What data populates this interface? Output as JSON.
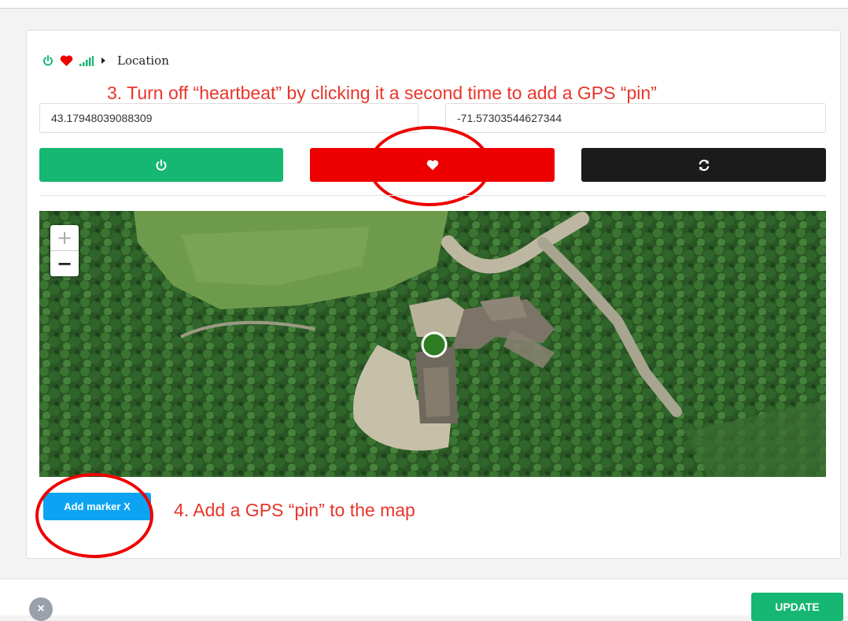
{
  "breadcrumb": {
    "title": "Location",
    "icons": [
      "power-icon",
      "heart-icon",
      "signal-icon",
      "caret-right-icon"
    ]
  },
  "annotations": {
    "step3": "3. Turn off “heartbeat” by clicking it a second time to add a GPS “pin”",
    "step4": "4. Add a GPS “pin” to the map"
  },
  "location": {
    "latitude": "43.17948039088309",
    "longitude": "-71.57303544627344"
  },
  "actions": {
    "power_icon": "power-icon",
    "heartbeat_icon": "heart-icon",
    "refresh_icon": "refresh-icon"
  },
  "map": {
    "zoom_in": "+",
    "zoom_out": "−",
    "marker_icon": "location-dot-icon"
  },
  "add_marker_label": "Add marker X",
  "footer": {
    "close_label": "×",
    "update_label": "UPDATE"
  },
  "colors": {
    "green": "#16b673",
    "red": "#ee0000",
    "dark": "#1b1b1b",
    "blue": "#0ca4f2",
    "annotation": "#e8352a"
  }
}
